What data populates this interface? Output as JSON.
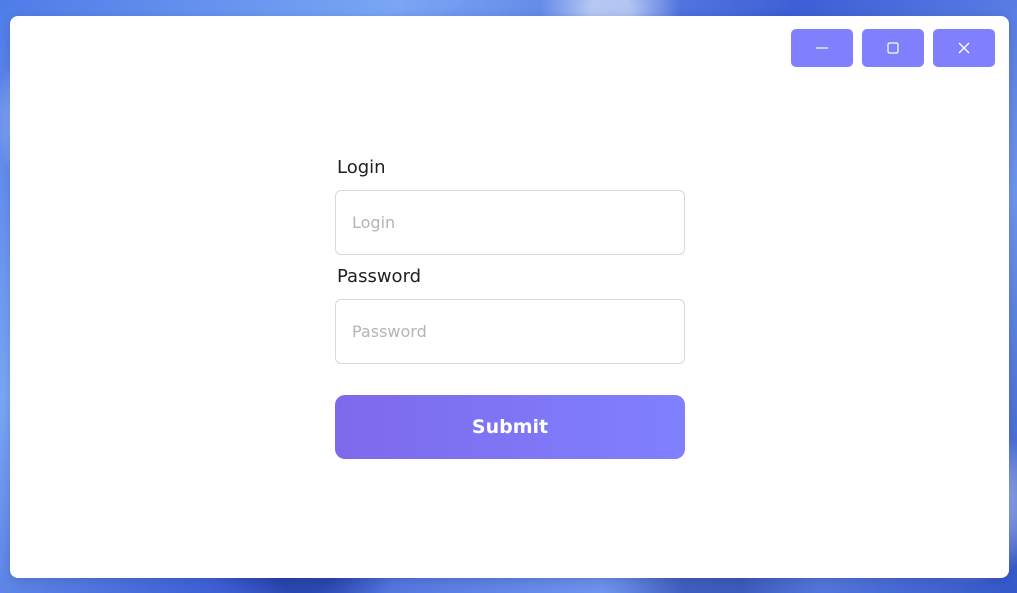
{
  "window": {
    "controls": [
      {
        "name": "minimize-button",
        "icon": "minimize-icon"
      },
      {
        "name": "maximize-button",
        "icon": "maximize-icon"
      },
      {
        "name": "close-button",
        "icon": "close-icon"
      }
    ],
    "accent_color": "#8080ff"
  },
  "form": {
    "login": {
      "label": "Login",
      "placeholder": "Login",
      "value": ""
    },
    "password": {
      "label": "Password",
      "placeholder": "Password",
      "value": ""
    },
    "submit_label": "Submit",
    "submit_gradient": [
      "#7d6aeb",
      "#8080ff"
    ]
  }
}
